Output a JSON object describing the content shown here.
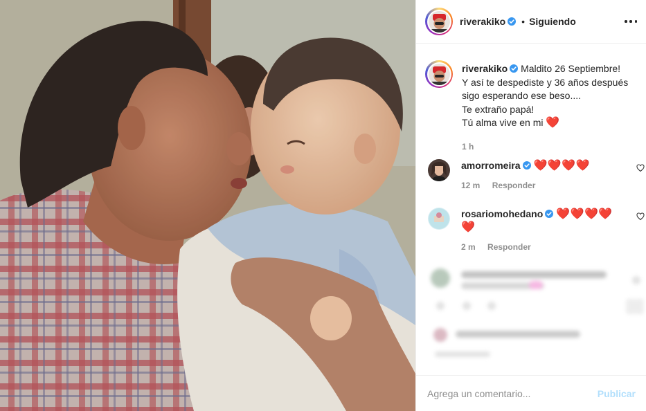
{
  "post": {
    "username": "riverakiko",
    "follow_status": "Siguiendo",
    "separator": "•"
  },
  "caption": {
    "username": "riverakiko",
    "line1": "Maldito 26 Septiembre!",
    "line2": "Y así te despediste y 36 años después sigo esperando ese beso....",
    "line3": "Te extraño papá!",
    "line4": "Tú alma vive en mi",
    "line4_emoji": "❤️",
    "time": "1 h"
  },
  "comments": [
    {
      "username": "amorromeira",
      "text": "❤️❤️❤️❤️",
      "time": "12 m",
      "reply_label": "Responder"
    },
    {
      "username": "rosariomohedano",
      "text": "❤️❤️❤️❤️",
      "text_wrap": "❤️",
      "time": "2 m",
      "reply_label": "Responder"
    }
  ],
  "composer": {
    "placeholder": "Agrega un comentario...",
    "publish_label": "Publicar"
  },
  "colors": {
    "verified": "#3897f0",
    "heart": "#ed1c24",
    "publish_disabled": "#b2dffc",
    "muted": "#8e8e8e"
  }
}
